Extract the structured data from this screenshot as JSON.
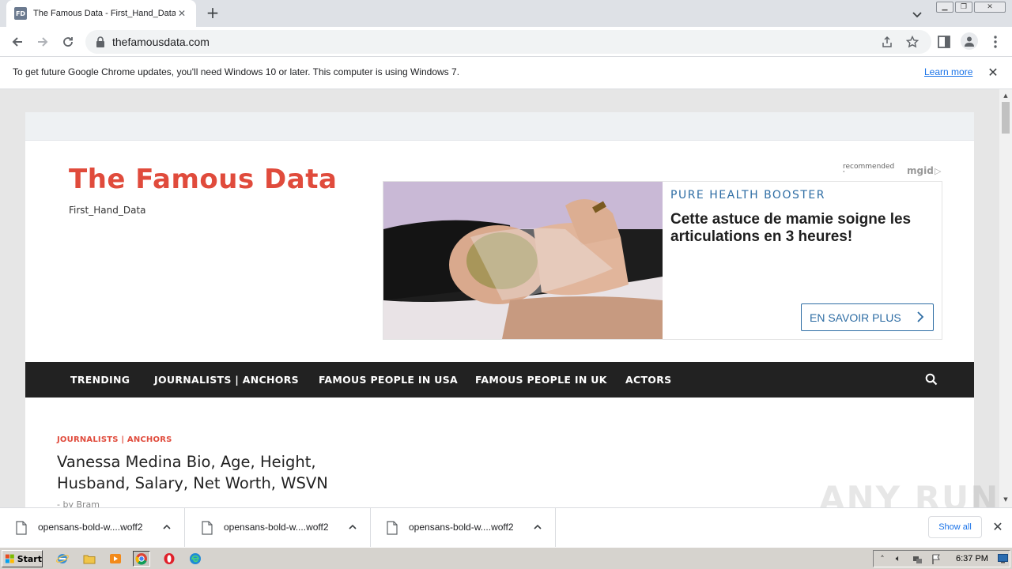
{
  "browser": {
    "tab": {
      "favicon_text": "FD",
      "title": "The Famous Data - First_Hand_Data"
    },
    "url": "thefamousdata.com",
    "infobar": {
      "message": "To get future Google Chrome updates, you'll need Windows 10 or later. This computer is using Windows 7.",
      "link": "Learn more"
    }
  },
  "site": {
    "title": "The Famous Data",
    "tagline": "First_Hand_Data",
    "ad": {
      "recommended_label": "recommended by",
      "brand": "mgid",
      "sponsor": "PURE HEALTH BOOSTER",
      "headline": "Cette astuce de mamie soigne les articulations en 3 heures!",
      "cta": "EN SAVOIR PLUS"
    },
    "nav": [
      {
        "label": "TRENDING"
      },
      {
        "label": "JOURNALISTS | ANCHORS"
      },
      {
        "label": "FAMOUS PEOPLE IN USA"
      },
      {
        "label": "FAMOUS PEOPLE IN UK"
      },
      {
        "label": "ACTORS"
      }
    ],
    "post": {
      "category": "JOURNALISTS | ANCHORS",
      "title": "Vanessa Medina Bio, Age, Height, Husband, Salary, Net Worth, WSVN",
      "meta": "- by Bram"
    }
  },
  "downloads": {
    "items": [
      {
        "name": "opensans-bold-w....woff2"
      },
      {
        "name": "opensans-bold-w....woff2"
      },
      {
        "name": "opensans-bold-w....woff2"
      }
    ],
    "show_all": "Show all"
  },
  "watermark": "ANY RUN",
  "taskbar": {
    "start": "Start",
    "clock": "6:37 PM"
  },
  "colors": {
    "brand_red": "#e04b3c",
    "nav_bg": "#222222",
    "ad_blue": "#2e6da4",
    "link_blue": "#1a73e8"
  }
}
